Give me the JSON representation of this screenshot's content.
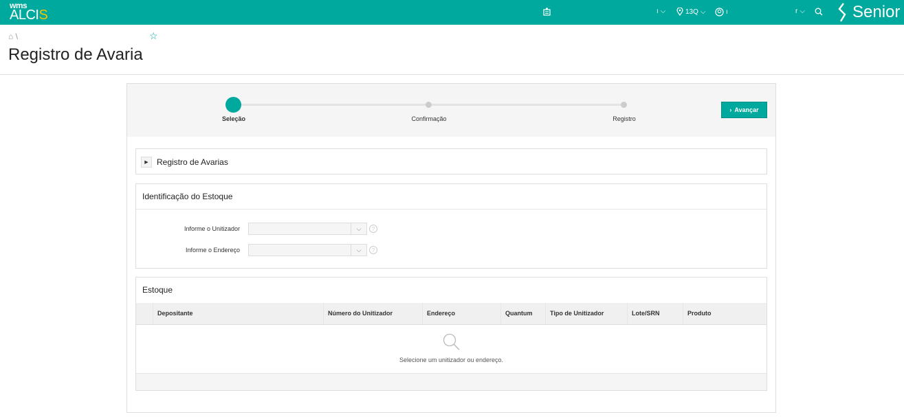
{
  "topbar": {
    "logo_top": "wms",
    "logo_main": "ALCI",
    "logo_accent": "S",
    "item1_text": "ı",
    "location": "13Q",
    "user_text": "ı",
    "item4_text": "r",
    "brand": "Senior"
  },
  "breadcrumb": {
    "separator": "\\"
  },
  "page_title": "Registro de Avaria",
  "stepper": {
    "steps": [
      {
        "label": "Seleção"
      },
      {
        "label": "Confirmação"
      },
      {
        "label": "Registro"
      }
    ],
    "next_button": "Avançar"
  },
  "panel_avarias": {
    "title": "Registro de Avarias"
  },
  "panel_ident": {
    "title": "Identificação do Estoque",
    "fields": [
      {
        "label": "Informe o Unitizador",
        "value": ""
      },
      {
        "label": "Informe o Endereço",
        "value": ""
      }
    ]
  },
  "panel_estoque": {
    "title": "Estoque",
    "columns": [
      "Depositante",
      "Número do Unitizador",
      "Endereço",
      "Quantum",
      "Tipo de Unitizador",
      "Lote/SRN",
      "Produto"
    ],
    "empty_message": "Selecione um unitizador ou endereço."
  },
  "colors": {
    "brand": "#00a99d",
    "logo_accent": "#f5c400"
  }
}
